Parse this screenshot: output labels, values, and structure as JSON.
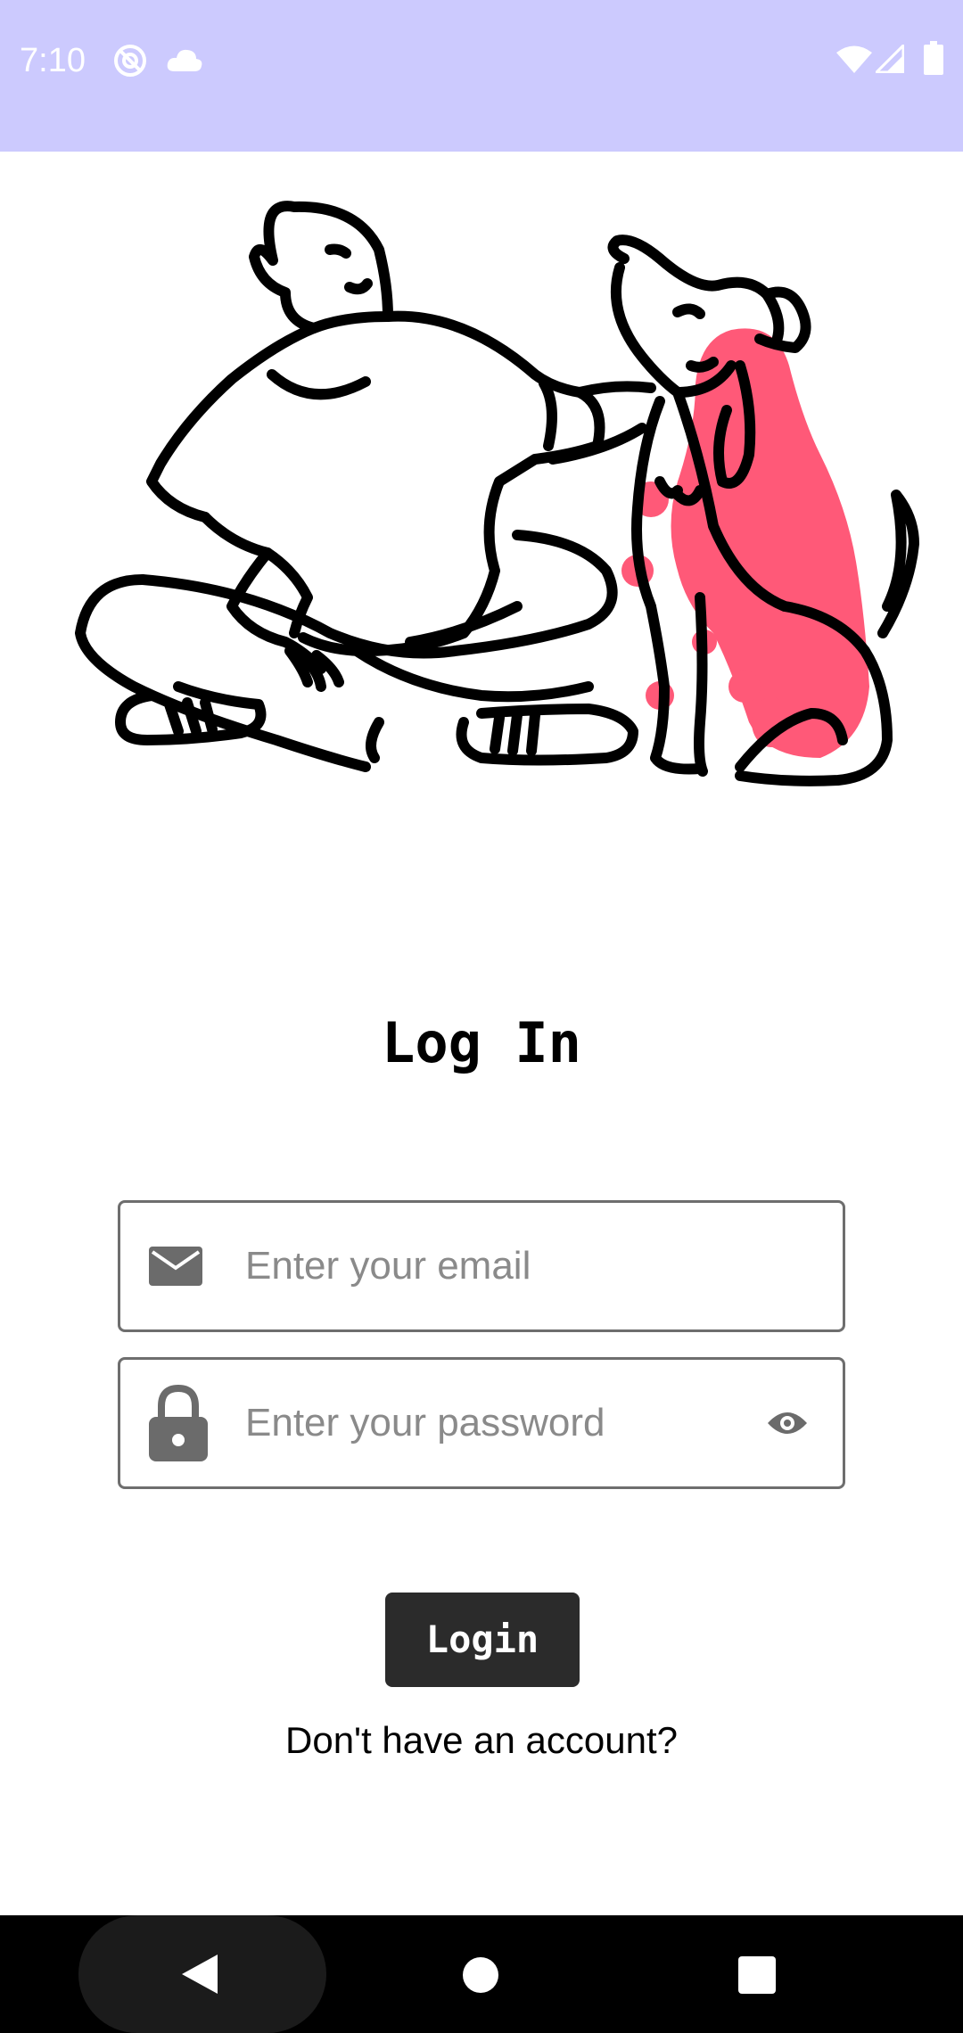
{
  "status_bar": {
    "time": "7:10",
    "icons": [
      "at-sign-icon",
      "cloud-icon",
      "wifi-icon",
      "signal-icon",
      "battery-icon"
    ],
    "background": "#cccafe"
  },
  "illustration": {
    "icon": "person-with-dog-illustration",
    "accent": "#ff5978"
  },
  "login": {
    "title": "Log In",
    "email_placeholder": "Enter your email",
    "password_placeholder": "Enter your password",
    "button_label": "Login",
    "signup_link": "Don't have an account?"
  },
  "nav_bar": {
    "icons": [
      "back-icon",
      "home-icon",
      "recents-icon"
    ]
  }
}
